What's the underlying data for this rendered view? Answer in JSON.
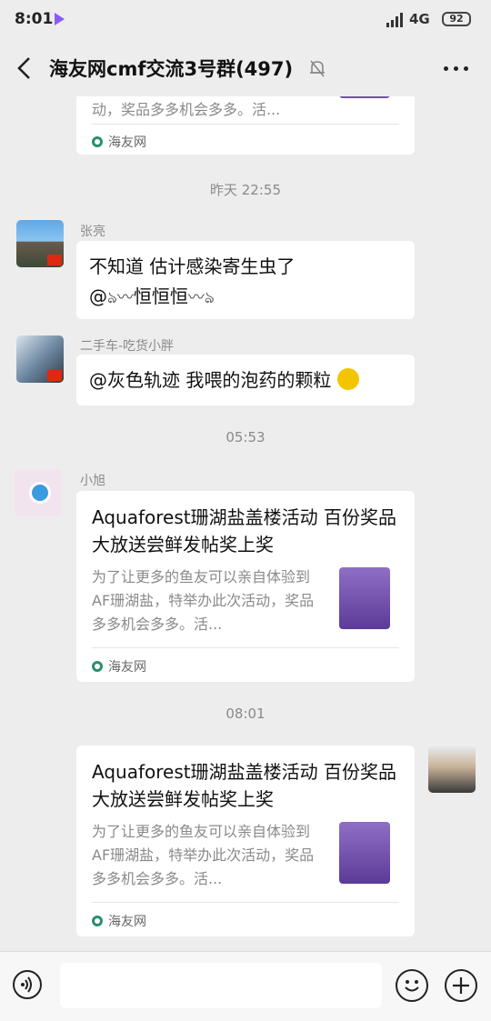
{
  "status_bar": {
    "time": "8:01",
    "network": "4G",
    "battery": "92"
  },
  "header": {
    "title": "海友网cmf交流3号群(497)"
  },
  "messages": {
    "top_card": {
      "desc": "动，奖品多多机会多多。活...",
      "source": "海友网"
    },
    "ts1": "昨天 22:55",
    "m1": {
      "sender": "张亮",
      "line1": "不知道 估计感染寄生虫了",
      "line2": "@",
      "line2b": "恒恒恒"
    },
    "m2": {
      "sender": "二手车-吃货小胖",
      "text": "@灰色轨迹  我喂的泡药的颗粒"
    },
    "ts2": "05:53",
    "m3": {
      "sender": "小旭",
      "title": "Aquaforest珊湖盐盖楼活动 百份奖品大放送尝鲜发帖奖上奖",
      "desc": "为了让更多的鱼友可以亲自体验到AF珊湖盐，特举办此次活动，奖品多多机会多多。活...",
      "source": "海友网"
    },
    "ts3": "08:01",
    "m4": {
      "title": "Aquaforest珊湖盐盖楼活动 百份奖品大放送尝鲜发帖奖上奖",
      "desc": "为了让更多的鱼友可以亲自体验到AF珊湖盐，特举办此次活动，奖品多多机会多多。活...",
      "source": "海友网"
    }
  },
  "input": {
    "value": ""
  }
}
